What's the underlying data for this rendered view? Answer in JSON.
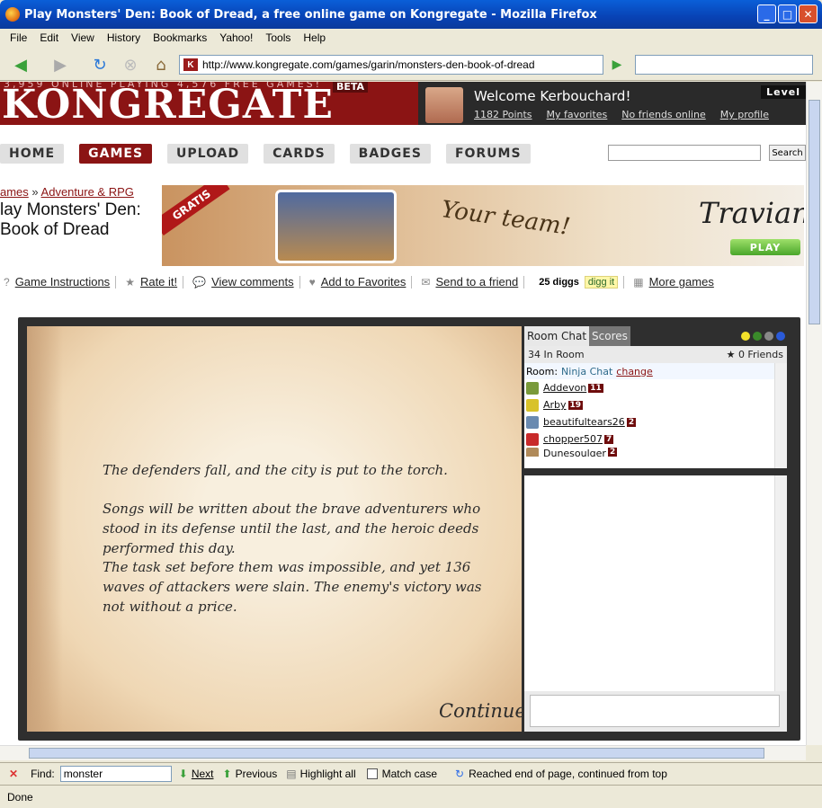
{
  "window": {
    "title": "Play Monsters' Den: Book of Dread, a free online game on Kongregate - Mozilla Firefox",
    "minimize": "_",
    "maximize": "□",
    "close": "✕"
  },
  "menu": [
    "File",
    "Edit",
    "View",
    "History",
    "Bookmarks",
    "Yahoo!",
    "Tools",
    "Help"
  ],
  "address": {
    "url": "http://www.kongregate.com/games/garin/monsters-den-book-of-dread",
    "favicon": "K"
  },
  "kongregate": {
    "ticker": "3,959 ONLINE PLAYING  4,576 FREE GAMES!",
    "beta": "BETA",
    "logo": "KONGREGATE",
    "welcome": "Welcome Kerbouchard!",
    "links": [
      "1182 Points",
      "My favorites",
      "No friends online",
      "My profile"
    ],
    "level": "Level",
    "nav": [
      "HOME",
      "GAMES",
      "UPLOAD",
      "CARDS",
      "BADGES",
      "FORUMS"
    ],
    "search_label": "Search",
    "breadcrumb": {
      "a": "ames",
      "sep": " » ",
      "b": "Adventure & RPG"
    },
    "game_title": "lay Monsters' Den: Book of Dread",
    "ad": {
      "gratis": "GRATIS",
      "team": "Your team!",
      "brand": "Travian",
      "play": "PLAY"
    },
    "actions": [
      "Game Instructions",
      "Rate it!",
      "View comments",
      "Add to Favorites",
      "Send to a friend"
    ],
    "diggs": "25 diggs",
    "diggit": "digg it",
    "more_games": "More games"
  },
  "game": {
    "p1": "The defenders fall, and the city is put to the torch.",
    "p2": "Songs will be written about the brave adventurers who stood in its defense until the last, and the heroic deeds performed this day.",
    "p3": "The task set before them was impossible, and yet 136 waves of attackers were slain. The enemy's victory was not without a price.",
    "continue": "Continue"
  },
  "chat": {
    "tabs": [
      "Room Chat",
      "Scores"
    ],
    "in_room": "34 In Room",
    "friends": "0 Friends",
    "room_label": "Room:",
    "room_name": "Ninja Chat",
    "change": "change",
    "users": [
      {
        "name": "Addevon",
        "level": "11"
      },
      {
        "name": "Arby",
        "level": "19"
      },
      {
        "name": "beautifultears26",
        "level": "2"
      },
      {
        "name": "chopper507",
        "level": "7"
      },
      {
        "name": "Dunesoulger",
        "level": "2"
      }
    ]
  },
  "find": {
    "label": "Find:",
    "value": "monster",
    "next": "Next",
    "previous": "Previous",
    "highlight": "Highlight all",
    "match_case": "Match case",
    "message": "Reached end of page, continued from top"
  },
  "status": "Done"
}
